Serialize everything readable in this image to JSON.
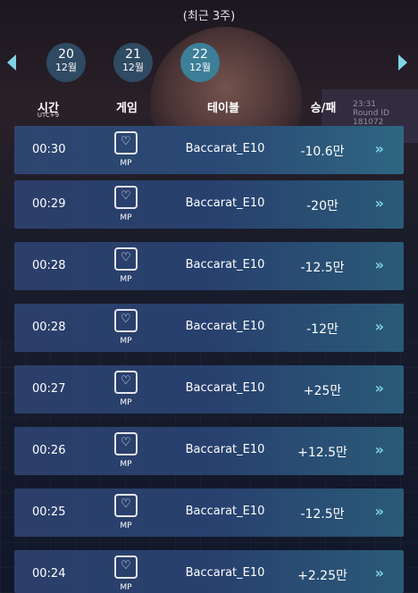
{
  "subtitle": "(최근 3주)",
  "dates": [
    {
      "day": "20",
      "month": "12월",
      "active": false
    },
    {
      "day": "21",
      "month": "12월",
      "active": false
    },
    {
      "day": "22",
      "month": "12월",
      "active": true
    }
  ],
  "columns": {
    "time": "시간",
    "time_sub": "UTC+9",
    "game": "게임",
    "table": "테이블",
    "result": "승/패"
  },
  "rows": [
    {
      "time": "00:30",
      "game": "MP",
      "table": "Baccarat_E10",
      "result": "-10.6만"
    },
    {
      "time": "00:29",
      "game": "MP",
      "table": "Baccarat_E10",
      "result": "-20만"
    },
    {
      "time": "00:28",
      "game": "MP",
      "table": "Baccarat_E10",
      "result": "-12.5만"
    },
    {
      "time": "00:28",
      "game": "MP",
      "table": "Baccarat_E10",
      "result": "-12만"
    },
    {
      "time": "00:27",
      "game": "MP",
      "table": "Baccarat_E10",
      "result": "+25만"
    },
    {
      "time": "00:26",
      "game": "MP",
      "table": "Baccarat_E10",
      "result": "+12.5만"
    },
    {
      "time": "00:25",
      "game": "MP",
      "table": "Baccarat_E10",
      "result": "-12.5만"
    },
    {
      "time": "00:24",
      "game": "MP",
      "table": "Baccarat_E10",
      "result": "+2.25만"
    }
  ],
  "background_board": {
    "line1": "23:31",
    "line2": "Round ID",
    "line3": "181072"
  },
  "colors": {
    "accent": "#7fd3e6",
    "active_date": "#3d7f98",
    "date": "#2f4a63"
  },
  "icons": {
    "row_arrow": "»",
    "game_icon": "playing-card-heart-icon"
  }
}
